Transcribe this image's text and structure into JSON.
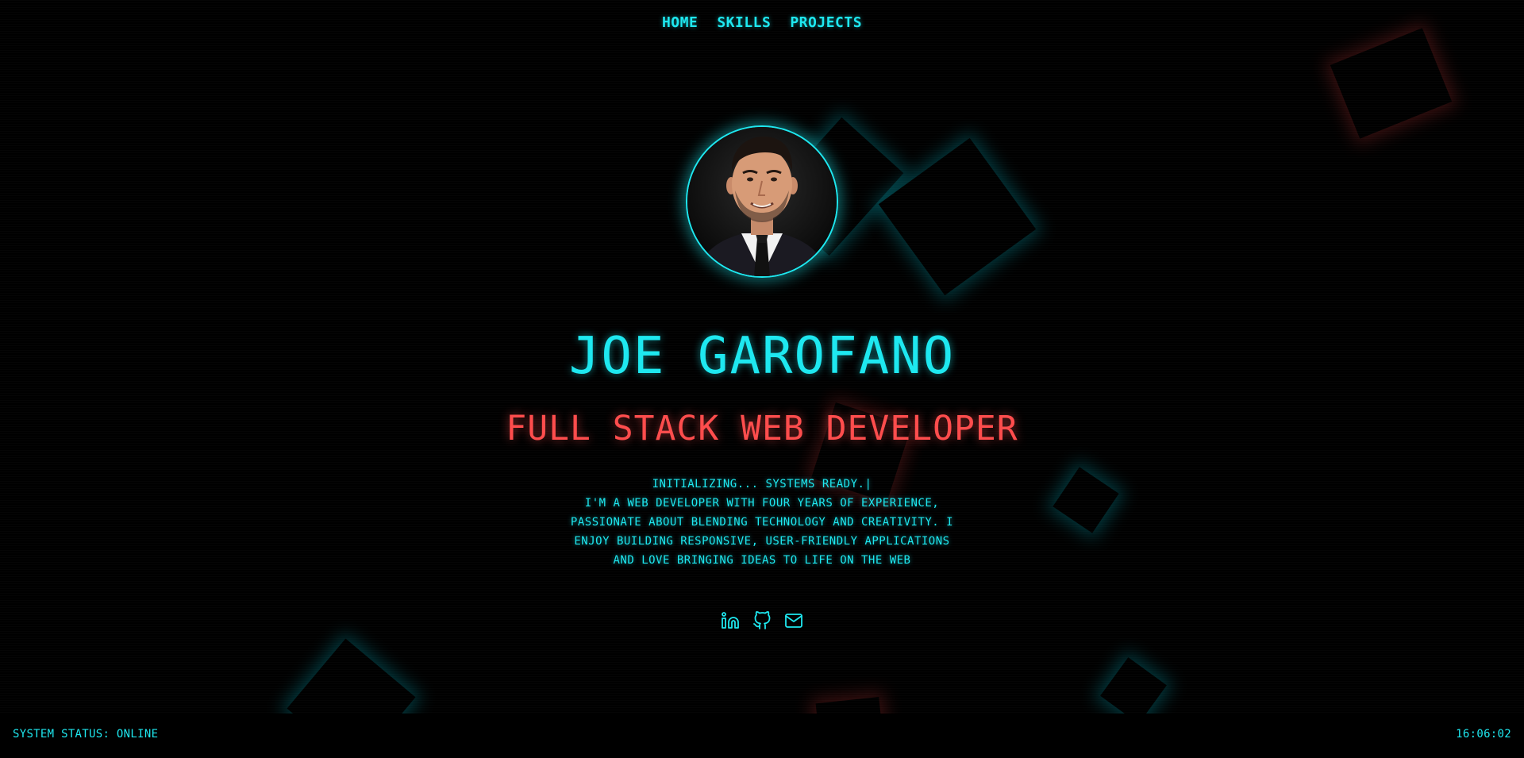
{
  "nav": {
    "items": [
      {
        "label": "HOME"
      },
      {
        "label": "SKILLS"
      },
      {
        "label": "PROJECTS"
      }
    ]
  },
  "hero": {
    "name": "JOE GAROFANO",
    "role": "FULL STACK WEB DEVELOPER",
    "intro_line": "INITIALIZING... SYSTEMS READY.",
    "cursor": "|",
    "bio": "I'M A WEB DEVELOPER WITH FOUR YEARS OF EXPERIENCE, PASSIONATE ABOUT BLENDING TECHNOLOGY AND CREATIVITY. I ENJOY BUILDING RESPONSIVE, USER-FRIENDLY APPLICATIONS AND LOVE BRINGING IDEAS TO LIFE ON THE WEB"
  },
  "socials": [
    {
      "icon": "linkedin-icon"
    },
    {
      "icon": "github-icon"
    },
    {
      "icon": "mail-icon"
    }
  ],
  "status": {
    "text": "SYSTEM STATUS: ONLINE",
    "clock": "16:06:02"
  },
  "colors": {
    "accent": "#1ee8f0",
    "highlight": "#ff4d4d",
    "background": "#000000"
  }
}
